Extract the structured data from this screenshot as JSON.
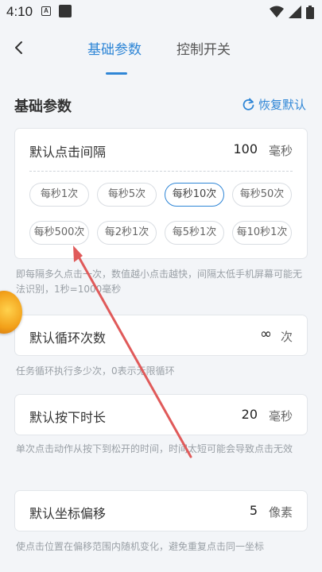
{
  "status": {
    "time": "4:10",
    "a_badge": "A"
  },
  "tabs": {
    "basic": "基础参数",
    "switch": "控制开关"
  },
  "section": {
    "title": "基础参数",
    "restore": "恢复默认"
  },
  "click_interval": {
    "label": "默认点击间隔",
    "value": "100",
    "unit": "毫秒",
    "chips": [
      "每秒1次",
      "每秒5次",
      "每秒10次",
      "每秒50次",
      "每秒500次",
      "每2秒1次",
      "每5秒1次",
      "每10秒1次"
    ],
    "selected": "每秒10次",
    "help": "即每隔多久点击一次，数值越小点击越快，间隔太低手机屏幕可能无法识别，1秒=1000毫秒"
  },
  "loop_count": {
    "label": "默认循环次数",
    "value": "∞",
    "unit": "次",
    "help": "任务循环执行多少次，0表示无限循环"
  },
  "press_duration": {
    "label": "默认按下时长",
    "value": "20",
    "unit": "毫秒",
    "help": "单次点击动作从按下到松开的时间，时间太短可能会导致点击无效"
  },
  "coord_offset": {
    "label": "默认坐标偏移",
    "value": "5",
    "unit": "像素",
    "help": "使点击位置在偏移范围内随机变化，避免重复点击同一坐标"
  },
  "colors": {
    "accent": "#2f86d6",
    "annotation_arrow": "#e05a5a"
  },
  "icons": {
    "back": "chevron-left-icon",
    "restore": "refresh-icon",
    "wifi": "wifi-icon",
    "signal": "signal-icon",
    "battery": "battery-icon"
  }
}
